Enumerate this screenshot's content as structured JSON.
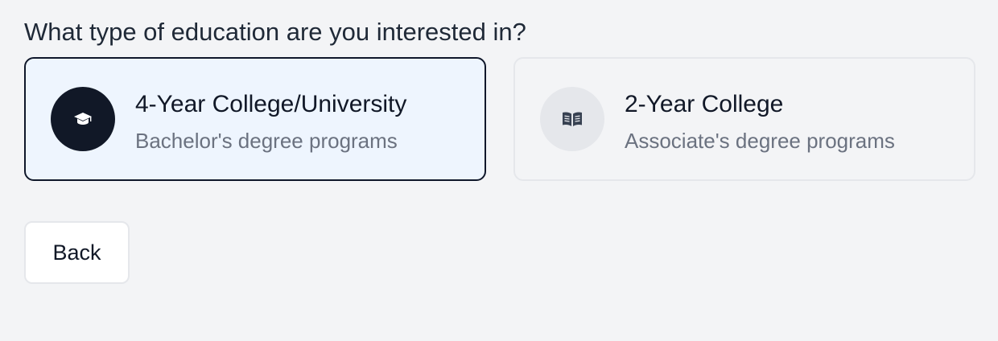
{
  "question": "What type of education are you interested in?",
  "options": [
    {
      "title": "4-Year College/University",
      "subtitle": "Bachelor's degree programs",
      "icon": "graduation-cap-icon",
      "selected": true
    },
    {
      "title": "2-Year College",
      "subtitle": "Associate's degree programs",
      "icon": "open-book-icon",
      "selected": false
    }
  ],
  "back_button": "Back",
  "colors": {
    "background": "#f3f4f6",
    "selected_card_bg": "#eef5fe",
    "selected_border": "#0f172a",
    "unselected_border": "#e5e7eb",
    "icon_dark_bg": "#111827",
    "icon_light_bg": "#e5e7eb",
    "subtitle_text": "#6b7280"
  }
}
